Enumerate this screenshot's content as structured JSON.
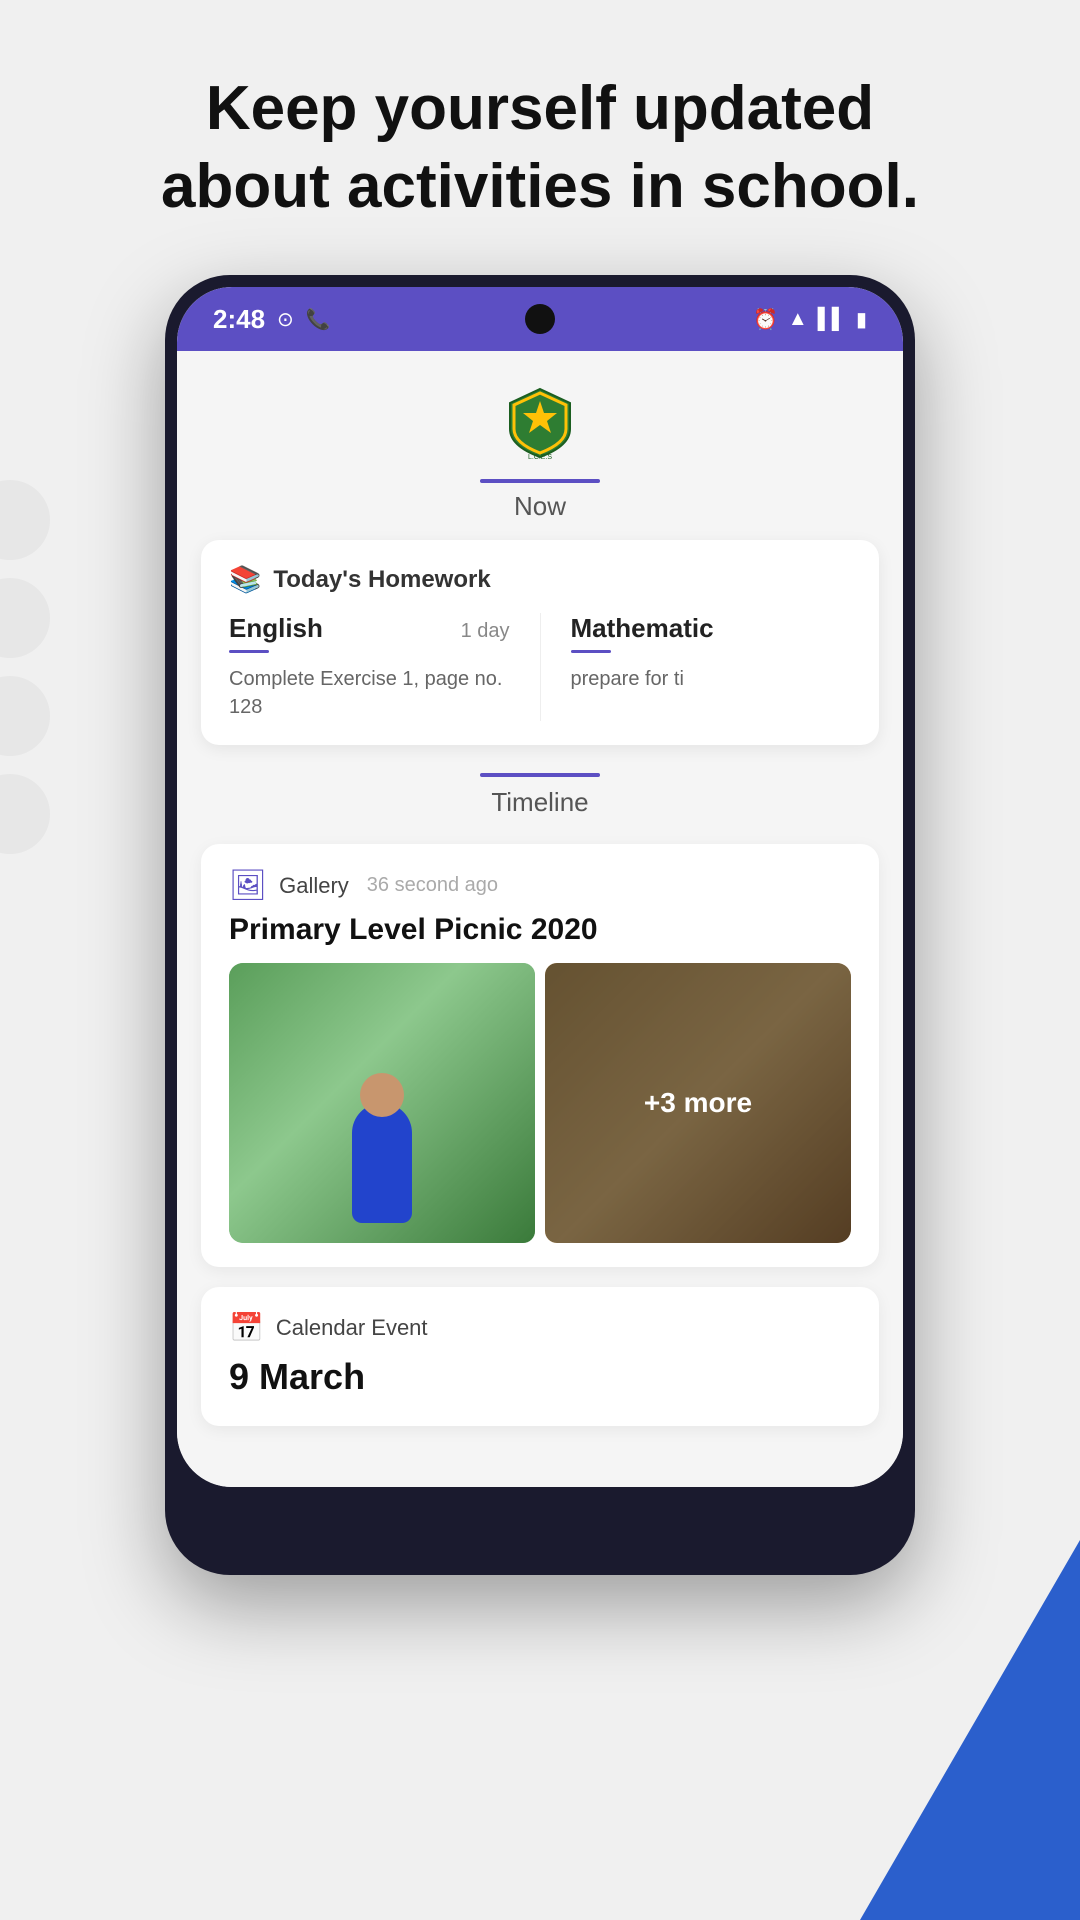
{
  "page": {
    "header_line1": "Keep yourself updated",
    "header_line2": "about activities in school."
  },
  "status_bar": {
    "time": "2:48",
    "left_icons": [
      "spotify-icon",
      "whatsapp-icon"
    ],
    "right_icons": [
      "alarm-icon",
      "wifi-icon",
      "signal-icon",
      "battery-icon"
    ]
  },
  "app": {
    "logo_alt": "School Logo",
    "tab_now": "Now",
    "tab_timeline": "Timeline"
  },
  "homework": {
    "section_title": "Today's Homework",
    "subjects": [
      {
        "name": "English",
        "due": "1 day",
        "description": "Complete Exercise 1, page no. 128"
      },
      {
        "name": "Mathematic",
        "due": "",
        "description": "prepare for ti"
      }
    ]
  },
  "timeline": {
    "events": [
      {
        "type": "Gallery",
        "time_ago": "36 second ago",
        "title": "Primary Level Picnic 2020",
        "photos_count": 5,
        "more_count": "+3 more"
      },
      {
        "type": "Calendar Event",
        "date": "9 March",
        "description": ""
      }
    ]
  }
}
